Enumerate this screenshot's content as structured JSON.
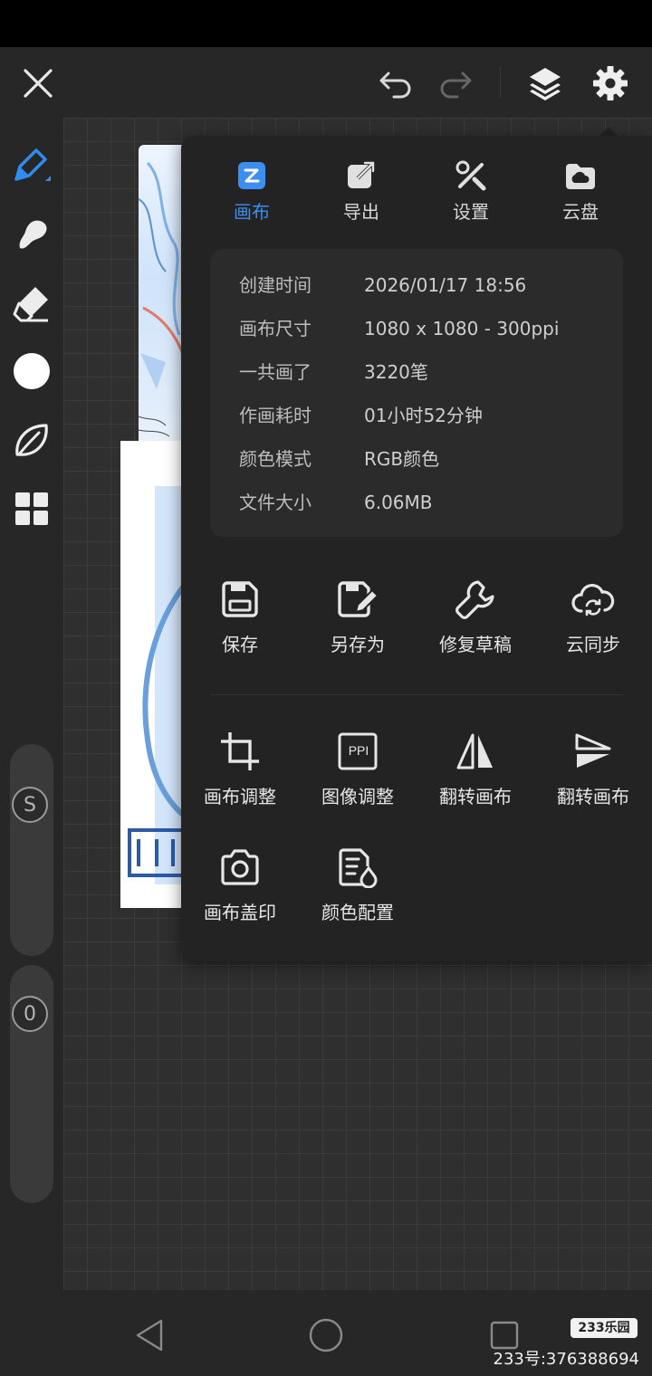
{
  "topbar": {
    "close_icon": "close-icon",
    "undo_icon": "undo-icon",
    "redo_icon": "redo-icon",
    "layers_icon": "layers-icon",
    "settings_icon": "gear-icon"
  },
  "tools": [
    {
      "name": "brush-pen",
      "icon": "pen-icon",
      "active": true
    },
    {
      "name": "smudge",
      "icon": "smudge-icon"
    },
    {
      "name": "eraser",
      "icon": "eraser-icon"
    },
    {
      "name": "color",
      "icon": "color-dot-icon",
      "color": "#ffffff"
    },
    {
      "name": "leaf",
      "icon": "leaf-icon"
    },
    {
      "name": "more",
      "icon": "grid-icon"
    }
  ],
  "sliders": {
    "size_label": "S",
    "opacity_label": "0"
  },
  "panel": {
    "tabs": [
      {
        "label": "画布",
        "active": true
      },
      {
        "label": "导出"
      },
      {
        "label": "设置"
      },
      {
        "label": "云盘"
      }
    ],
    "info": [
      {
        "key": "创建时间",
        "value": "2026/01/17 18:56"
      },
      {
        "key": "画布尺寸",
        "value": "1080 x 1080 - 300ppi"
      },
      {
        "key": "一共画了",
        "value": "3220笔"
      },
      {
        "key": "作画耗时",
        "value": "01小时52分钟"
      },
      {
        "key": "颜色模式",
        "value": "RGB颜色"
      },
      {
        "key": "文件大小",
        "value": "6.06MB"
      }
    ],
    "actions_row1": [
      {
        "label": "保存",
        "icon": "save-icon"
      },
      {
        "label": "另存为",
        "icon": "save-as-icon"
      },
      {
        "label": "修复草稿",
        "icon": "wrench-icon"
      },
      {
        "label": "云同步",
        "icon": "cloud-sync-icon"
      }
    ],
    "actions_row2": [
      {
        "label": "画布调整",
        "icon": "crop-icon"
      },
      {
        "label": "图像调整",
        "icon": "ppi-icon",
        "icon_text": "PPI"
      },
      {
        "label": "翻转画布",
        "icon": "flip-horizontal-icon"
      },
      {
        "label": "翻转画布",
        "icon": "flip-vertical-icon"
      }
    ],
    "actions_row3": [
      {
        "label": "画布盖印",
        "icon": "camera-icon"
      },
      {
        "label": "颜色配置",
        "icon": "color-config-icon"
      }
    ]
  },
  "watermark": {
    "badge": "233乐园",
    "text": "233号:376388694"
  },
  "colors": {
    "accent": "#3a8ff0",
    "panel_bg": "#232323",
    "card_bg": "#2b2b2b"
  }
}
